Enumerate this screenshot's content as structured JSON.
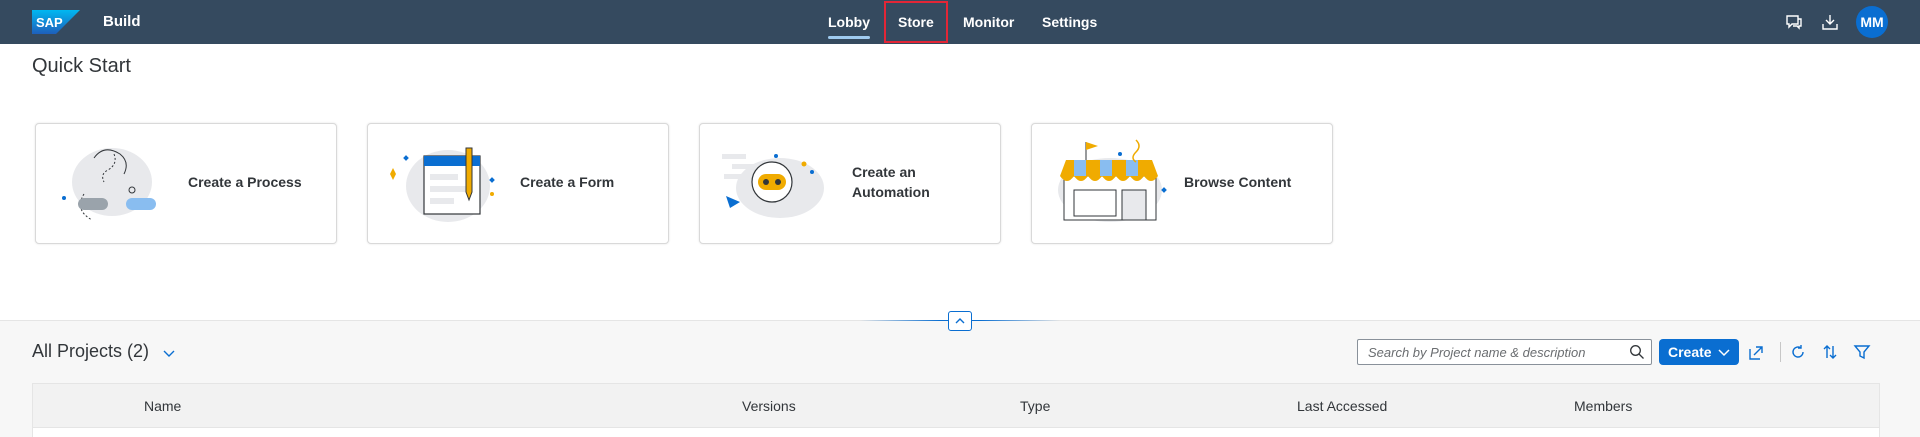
{
  "shell": {
    "logo_text": "SAP",
    "product": "Build",
    "nav": [
      {
        "label": "Lobby",
        "active": true
      },
      {
        "label": "Store",
        "active": false,
        "highlighted": true
      },
      {
        "label": "Monitor",
        "active": false
      },
      {
        "label": "Settings",
        "active": false
      }
    ],
    "icons": [
      "feedback-icon",
      "download-icon"
    ],
    "avatar_initials": "MM"
  },
  "quick_start": {
    "title": "Quick Start",
    "cards": [
      {
        "label": "Create a Process",
        "icon": "process-illustration"
      },
      {
        "label": "Create a Form",
        "icon": "form-illustration"
      },
      {
        "label_line1": "Create an",
        "label_line2": "Automation",
        "icon": "automation-illustration"
      },
      {
        "label": "Browse Content",
        "icon": "store-illustration"
      }
    ]
  },
  "projects": {
    "title": "All Projects (2)",
    "search_placeholder": "Search by Project name & description",
    "create_label": "Create",
    "toolbar_icons": [
      "import-icon",
      "refresh-icon",
      "sort-icon",
      "filter-icon"
    ],
    "columns": [
      "Name",
      "Versions",
      "Type",
      "Last Accessed",
      "Members"
    ]
  },
  "colors": {
    "shell_bg": "#354a5f",
    "brand_blue": "#0a6ed1",
    "highlight_border": "#e32636"
  }
}
